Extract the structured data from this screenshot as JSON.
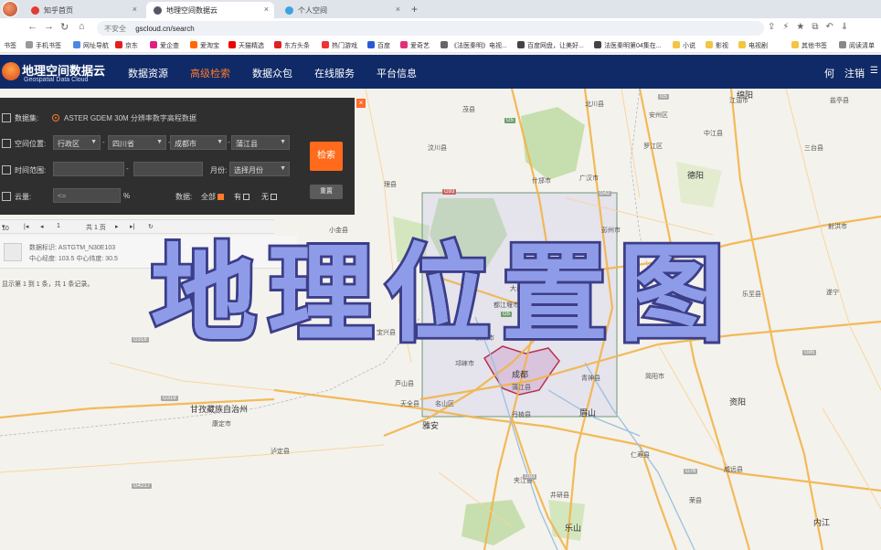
{
  "browser": {
    "tabs": [
      {
        "label": "知乎首页"
      },
      {
        "label": "地理空间数据云"
      },
      {
        "label": "个人空间"
      }
    ],
    "address": {
      "warning": "不安全",
      "url": "gscloud.cn/search"
    },
    "bookmarks": [
      "书签",
      "手机书签",
      "网址导航",
      "京东",
      "爱企查",
      "爱淘宝",
      "天猫精选",
      "东方头条",
      "热门游戏",
      "百度",
      "爱奇艺",
      "《法医秦明》电视...",
      "百度网盘，让美好...",
      "法医秦明第04集在...",
      "小说",
      "影视",
      "电视剧",
      "其他书签",
      "阅读清单"
    ]
  },
  "site": {
    "logo_cn": "地理空间数据云",
    "logo_en": "Geospatial Data Cloud",
    "nav": [
      "数据资源",
      "高级检索",
      "数据众包",
      "在线服务",
      "平台信息"
    ],
    "active_nav": "高级检索",
    "user": "何",
    "logout": "注销"
  },
  "search_panel": {
    "dataset_label": "数据集:",
    "dataset_value": "ASTER GDEM 30M 分辨率数字高程数据",
    "region_label": "空间位置:",
    "region_type": "行政区",
    "province": "四川省",
    "city": "成都市",
    "district": "蒲江县",
    "time_label": "时间范围:",
    "month_label": "月份:",
    "month_value": "选择月份",
    "cloud_label": "云量:",
    "cloud_op": "<=",
    "cloud_unit": "%",
    "data_label": "数据:",
    "opt_all": "全部",
    "opt_has": "有",
    "opt_none": "无",
    "search_btn": "检索",
    "reset_btn": "重置"
  },
  "results": {
    "page_size": "10",
    "page_num": "1",
    "page_total": "共 1 页",
    "item_line1": "数据标识: ASTGTM_N30E103",
    "item_line2": "中心经度: 103.5 中心纬度: 30.5",
    "summary": "显示第 1 到 1 条，共 1 条记录。"
  },
  "map": {
    "cities": [
      "绵阳",
      "德阳",
      "成都",
      "眉山",
      "乐山",
      "资阳",
      "雅安",
      "内江",
      "甘孜藏族自治州"
    ],
    "labels": [
      "广汉市",
      "什邡市",
      "彭州市",
      "都江堰市",
      "崇州市",
      "大邑县",
      "邛崃市",
      "蒲江县",
      "名山区",
      "芦山县",
      "天全县",
      "宝兴县",
      "丹棱县",
      "夹江县",
      "青神县",
      "乐至县",
      "中江县",
      "罗江区",
      "安州区",
      "江油市",
      "三台县",
      "盐亭县",
      "射洪市",
      "遂宁",
      "简阳市",
      "仁寿县",
      "井研县",
      "威远县",
      "荣县",
      "泸定县",
      "康定市",
      "小金县",
      "汶川县",
      "茂县",
      "理县",
      "北川县"
    ]
  },
  "overlay_text": "地理位置图"
}
